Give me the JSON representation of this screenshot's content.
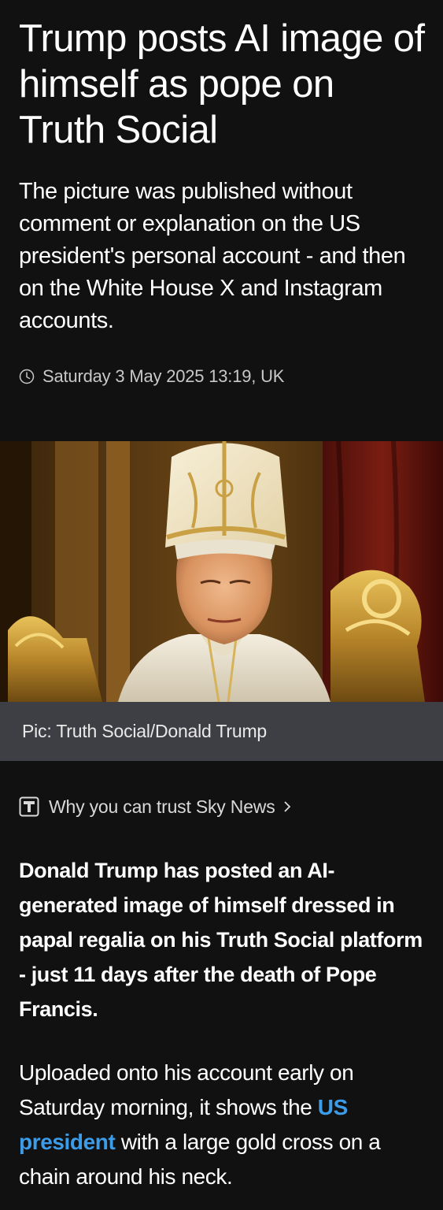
{
  "article": {
    "headline": "Trump posts AI image of himself as pope on Truth Social",
    "standfirst": "The picture was published without comment or explanation on the US president's personal account - and then on the White House X and Instagram accounts.",
    "timestamp": "Saturday 3 May 2025 13:19, UK",
    "image": {
      "subject": "AI image of Donald Trump dressed as pope seated on gilded throne",
      "caption": "Pic: Truth Social/Donald Trump"
    },
    "trust_link": {
      "label": "Why you can trust Sky News",
      "icon": "trust-t-icon"
    },
    "lede": "Donald Trump has posted an AI-generated image of himself dressed in papal regalia on his Truth Social platform - just 11 days after the death of Pope Francis.",
    "paragraph": {
      "before_link": "Uploaded onto his account early on Saturday morning, it shows the ",
      "link_text": "US president",
      "after_link": " with a large gold cross on a chain around his neck."
    }
  },
  "colors": {
    "background": "#111111",
    "caption_bar": "#3e3f44",
    "link": "#3d9ce8",
    "meta_text": "#c8c8c8"
  }
}
